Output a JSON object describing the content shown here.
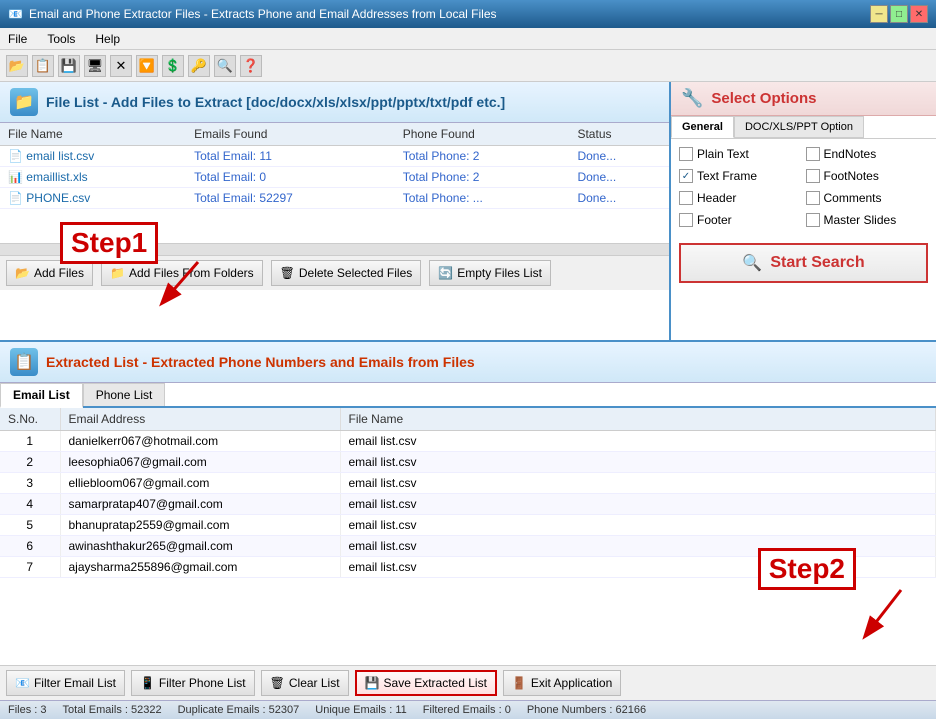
{
  "window": {
    "title": "Email and Phone Extractor Files  -  Extracts Phone and Email Addresses from Local Files",
    "icon": "📧"
  },
  "menu": {
    "items": [
      "File",
      "Tools",
      "Help"
    ]
  },
  "file_list": {
    "header": "File List - Add Files to Extract  [doc/docx/xls/xlsx/ppt/pptx/txt/pdf etc.]",
    "columns": [
      "File Name",
      "Emails Found",
      "Phone Found",
      "Status"
    ],
    "rows": [
      {
        "name": "email list.csv",
        "icon": "📄",
        "emails": "Total Email: 11",
        "phones": "Total Phone: 2",
        "status": "Done..."
      },
      {
        "name": "emaillist.xls",
        "icon": "📊",
        "emails": "Total Email: 0",
        "phones": "Total Phone: 2",
        "status": "Done..."
      },
      {
        "name": "PHONE.csv",
        "icon": "📄",
        "emails": "Total Email: 52297",
        "phones": "Total Phone: ...",
        "status": "Done..."
      }
    ],
    "toolbar": {
      "add_files": "Add Files",
      "add_folder": "Add Files From Folders",
      "delete": "Delete Selected Files",
      "empty": "Empty Files List"
    }
  },
  "options": {
    "header": "Select Options",
    "tabs": [
      "General",
      "DOC/XLS/PPT Option"
    ],
    "items": [
      {
        "label": "Plain Text",
        "checked": false
      },
      {
        "label": "EndNotes",
        "checked": false
      },
      {
        "label": "Text Frame",
        "checked": true
      },
      {
        "label": "FootNotes",
        "checked": false
      },
      {
        "label": "Header",
        "checked": false
      },
      {
        "label": "Comments",
        "checked": false
      },
      {
        "label": "Footer",
        "checked": false
      },
      {
        "label": "Master Slides",
        "checked": false
      }
    ],
    "start_search": "Start Search"
  },
  "extracted": {
    "header": "Extracted List - Extracted Phone Numbers and Emails from Files",
    "tabs": [
      "Email List",
      "Phone List"
    ],
    "columns": [
      "S.No.",
      "Email Address",
      "File Name"
    ],
    "rows": [
      {
        "sno": "1",
        "email": "danielkerr067@hotmail.com",
        "file": "email list.csv"
      },
      {
        "sno": "2",
        "email": "leesophia067@gmail.com",
        "file": "email list.csv"
      },
      {
        "sno": "3",
        "email": "elliebloom067@gmail.com",
        "file": "email list.csv"
      },
      {
        "sno": "4",
        "email": "samarpratap407@gmail.com",
        "file": "email list.csv"
      },
      {
        "sno": "5",
        "email": "bhanupratap2559@gmail.com",
        "file": "email list.csv"
      },
      {
        "sno": "6",
        "email": "awinashthakur265@gmail.com",
        "file": "email list.csv"
      },
      {
        "sno": "7",
        "email": "ajaysharma255896@gmail.com",
        "file": "email list.csv"
      }
    ],
    "toolbar": {
      "filter_email": "Filter Email List",
      "filter_phone": "Filter Phone List",
      "clear": "Clear List",
      "save": "Save Extracted List",
      "exit": "Exit Application"
    }
  },
  "status_bar": {
    "files": "Files : 3",
    "total_emails": "Total Emails : 52322",
    "duplicate_emails": "Duplicate Emails : 52307",
    "unique_emails": "Unique Emails : 11",
    "filtered_emails": "Filtered Emails : 0",
    "phone_numbers": "Phone Numbers : 62166"
  },
  "step1": "Step1",
  "step2": "Step2"
}
